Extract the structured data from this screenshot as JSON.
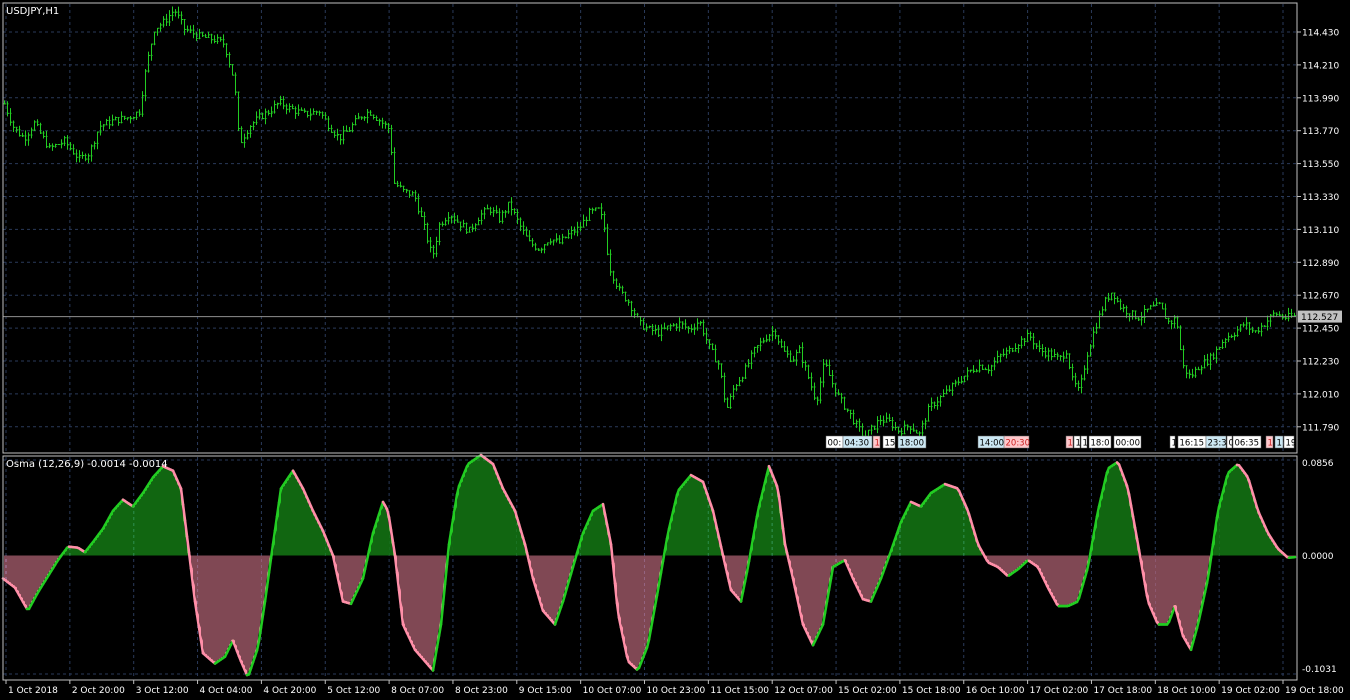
{
  "window": {
    "main_title": "USDJPY,H1",
    "indicator_title": "Osma (12,26,9) -0.0014 -0.0014"
  },
  "colors": {
    "background": "#000000",
    "frame": "#c0c0c0",
    "grid": "#2a3a5a",
    "candle": "#22cc22",
    "price_line": "#909090",
    "price_label_bg": "#c0c0c0",
    "osma_positive": "#22cc22",
    "osma_negative": "#ff8fa8",
    "text": "#ffffff"
  },
  "price_axis": {
    "labels": [
      "114.430",
      "114.210",
      "113.990",
      "113.770",
      "113.550",
      "113.330",
      "113.110",
      "112.890",
      "112.670",
      "112.450",
      "112.230",
      "112.010",
      "111.790"
    ],
    "current_price": "112.527"
  },
  "osma_axis": {
    "labels": [
      "0.0856",
      "0.0000",
      "-0.1031"
    ]
  },
  "time_axis": {
    "labels": [
      "1 Oct 2018",
      "2 Oct 20:00",
      "3 Oct 12:00",
      "4 Oct 04:00",
      "4 Oct 20:00",
      "5 Oct 12:00",
      "8 Oct 07:00",
      "8 Oct 23:00",
      "9 Oct 15:00",
      "10 Oct 07:00",
      "10 Oct 23:00",
      "11 Oct 15:00",
      "12 Oct 07:00",
      "15 Oct 02:00",
      "15 Oct 18:00",
      "16 Oct 10:00",
      "17 Oct 02:00",
      "17 Oct 18:00",
      "18 Oct 10:00",
      "19 Oct 02:00",
      "19 Oct 18:00"
    ]
  },
  "event_markers": [
    {
      "text": "00:",
      "tone": "white"
    },
    {
      "text": "04:30",
      "tone": "blue"
    },
    {
      "text": "1",
      "tone": "pink"
    },
    {
      "text": "15",
      "tone": "white"
    },
    {
      "text": "18:00",
      "tone": "blue"
    },
    {
      "text": "14:00",
      "tone": "blue"
    },
    {
      "text": "20:30",
      "tone": "pink"
    },
    {
      "text": "1",
      "tone": "pink"
    },
    {
      "text": "1",
      "tone": "white"
    },
    {
      "text": "1",
      "tone": "white"
    },
    {
      "text": "18:0",
      "tone": "white"
    },
    {
      "text": "00:00",
      "tone": "white"
    },
    {
      "text": "1",
      "tone": "white"
    },
    {
      "text": "16:15",
      "tone": "white"
    },
    {
      "text": "23:3",
      "tone": "blue"
    },
    {
      "text": "0",
      "tone": "white"
    },
    {
      "text": "06:35",
      "tone": "white"
    },
    {
      "text": "1",
      "tone": "pink"
    },
    {
      "text": "1",
      "tone": "blue"
    },
    {
      "text": "19",
      "tone": "white"
    }
  ],
  "chart_data": [
    {
      "type": "candlestick",
      "title": "USDJPY,H1",
      "ylim": [
        111.64,
        114.6
      ],
      "x_start": "1 Oct 2018",
      "x_end": "19 Oct 18:00",
      "y_ticks": [
        114.43,
        114.21,
        113.99,
        113.77,
        113.55,
        113.33,
        113.11,
        112.89,
        112.67,
        112.45,
        112.23,
        112.01,
        111.79
      ],
      "current_price": 112.527,
      "close_path": [
        [
          0,
          113.95
        ],
        [
          10,
          113.78
        ],
        [
          20,
          113.72
        ],
        [
          30,
          113.82
        ],
        [
          45,
          113.65
        ],
        [
          60,
          113.7
        ],
        [
          75,
          113.58
        ],
        [
          85,
          113.62
        ],
        [
          95,
          113.8
        ],
        [
          110,
          113.84
        ],
        [
          125,
          113.86
        ],
        [
          135,
          113.9
        ],
        [
          142,
          114.2
        ],
        [
          150,
          114.45
        ],
        [
          160,
          114.5
        ],
        [
          170,
          114.58
        ],
        [
          180,
          114.45
        ],
        [
          195,
          114.4
        ],
        [
          210,
          114.38
        ],
        [
          220,
          114.35
        ],
        [
          230,
          114.1
        ],
        [
          235,
          113.68
        ],
        [
          245,
          113.8
        ],
        [
          255,
          113.86
        ],
        [
          265,
          113.9
        ],
        [
          275,
          113.96
        ],
        [
          285,
          113.92
        ],
        [
          300,
          113.88
        ],
        [
          315,
          113.9
        ],
        [
          325,
          113.8
        ],
        [
          335,
          113.72
        ],
        [
          345,
          113.78
        ],
        [
          355,
          113.86
        ],
        [
          365,
          113.9
        ],
        [
          375,
          113.84
        ],
        [
          385,
          113.78
        ],
        [
          390,
          113.42
        ],
        [
          400,
          113.36
        ],
        [
          410,
          113.34
        ],
        [
          420,
          113.12
        ],
        [
          428,
          112.92
        ],
        [
          435,
          113.14
        ],
        [
          445,
          113.22
        ],
        [
          455,
          113.15
        ],
        [
          465,
          113.1
        ],
        [
          475,
          113.2
        ],
        [
          485,
          113.25
        ],
        [
          495,
          113.18
        ],
        [
          505,
          113.28
        ],
        [
          515,
          113.14
        ],
        [
          525,
          113.02
        ],
        [
          535,
          112.98
        ],
        [
          545,
          113.05
        ],
        [
          555,
          113.02
        ],
        [
          565,
          113.08
        ],
        [
          575,
          113.12
        ],
        [
          585,
          113.22
        ],
        [
          595,
          113.24
        ],
        [
          600,
          113.12
        ],
        [
          605,
          112.86
        ],
        [
          615,
          112.7
        ],
        [
          625,
          112.62
        ],
        [
          635,
          112.48
        ],
        [
          645,
          112.44
        ],
        [
          655,
          112.42
        ],
        [
          665,
          112.46
        ],
        [
          675,
          112.48
        ],
        [
          685,
          112.44
        ],
        [
          695,
          112.5
        ],
        [
          705,
          112.32
        ],
        [
          715,
          112.2
        ],
        [
          722,
          111.9
        ],
        [
          730,
          112.06
        ],
        [
          740,
          112.16
        ],
        [
          750,
          112.3
        ],
        [
          760,
          112.38
        ],
        [
          770,
          112.44
        ],
        [
          778,
          112.3
        ],
        [
          788,
          112.24
        ],
        [
          795,
          112.3
        ],
        [
          805,
          112.1
        ],
        [
          812,
          111.96
        ],
        [
          820,
          112.22
        ],
        [
          828,
          112.08
        ],
        [
          835,
          111.98
        ],
        [
          845,
          111.88
        ],
        [
          852,
          111.8
        ],
        [
          860,
          111.72
        ],
        [
          868,
          111.78
        ],
        [
          876,
          111.84
        ],
        [
          885,
          111.82
        ],
        [
          895,
          111.76
        ],
        [
          905,
          111.8
        ],
        [
          915,
          111.74
        ],
        [
          925,
          111.92
        ],
        [
          935,
          111.98
        ],
        [
          945,
          112.04
        ],
        [
          955,
          112.1
        ],
        [
          965,
          112.16
        ],
        [
          975,
          112.2
        ],
        [
          985,
          112.18
        ],
        [
          995,
          112.26
        ],
        [
          1005,
          112.3
        ],
        [
          1015,
          112.36
        ],
        [
          1025,
          112.4
        ],
        [
          1035,
          112.3
        ],
        [
          1045,
          112.28
        ],
        [
          1055,
          112.24
        ],
        [
          1062,
          112.3
        ],
        [
          1068,
          112.1
        ],
        [
          1075,
          112.02
        ],
        [
          1082,
          112.26
        ],
        [
          1090,
          112.44
        ],
        [
          1100,
          112.62
        ],
        [
          1108,
          112.7
        ],
        [
          1115,
          112.6
        ],
        [
          1125,
          112.55
        ],
        [
          1135,
          112.52
        ],
        [
          1145,
          112.58
        ],
        [
          1155,
          112.6
        ],
        [
          1165,
          112.48
        ],
        [
          1172,
          112.52
        ],
        [
          1178,
          112.2
        ],
        [
          1186,
          112.12
        ],
        [
          1195,
          112.2
        ],
        [
          1205,
          112.24
        ],
        [
          1212,
          112.3
        ],
        [
          1220,
          112.38
        ],
        [
          1230,
          112.42
        ],
        [
          1240,
          112.48
        ],
        [
          1250,
          112.42
        ],
        [
          1260,
          112.48
        ],
        [
          1270,
          112.55
        ],
        [
          1280,
          112.52
        ],
        [
          1292,
          112.53
        ]
      ]
    },
    {
      "type": "histogram",
      "title": "Osma (12,26,9) -0.0014 -0.0014",
      "series": [
        {
          "name": "Osma",
          "values": "osma_path"
        }
      ],
      "ylim": [
        -0.1031,
        0.0856
      ],
      "y_ticks": [
        0.0856,
        0.0,
        -0.1031
      ],
      "osma_path": [
        [
          0,
          -0.02
        ],
        [
          12,
          -0.028
        ],
        [
          25,
          -0.048
        ],
        [
          35,
          -0.032
        ],
        [
          45,
          -0.018
        ],
        [
          55,
          -0.004
        ],
        [
          65,
          0.008
        ],
        [
          75,
          0.007
        ],
        [
          82,
          0.003
        ],
        [
          90,
          0.012
        ],
        [
          100,
          0.024
        ],
        [
          110,
          0.04
        ],
        [
          120,
          0.05
        ],
        [
          130,
          0.044
        ],
        [
          140,
          0.056
        ],
        [
          150,
          0.07
        ],
        [
          160,
          0.08
        ],
        [
          170,
          0.076
        ],
        [
          178,
          0.06
        ],
        [
          185,
          0.01
        ],
        [
          192,
          -0.04
        ],
        [
          200,
          -0.085
        ],
        [
          212,
          -0.094
        ],
        [
          222,
          -0.088
        ],
        [
          230,
          -0.074
        ],
        [
          237,
          -0.09
        ],
        [
          245,
          -0.106
        ],
        [
          255,
          -0.08
        ],
        [
          262,
          -0.04
        ],
        [
          270,
          0.01
        ],
        [
          278,
          0.06
        ],
        [
          290,
          0.076
        ],
        [
          300,
          0.06
        ],
        [
          310,
          0.04
        ],
        [
          320,
          0.022
        ],
        [
          330,
          0.0
        ],
        [
          340,
          -0.04
        ],
        [
          348,
          -0.042
        ],
        [
          360,
          -0.02
        ],
        [
          370,
          0.02
        ],
        [
          380,
          0.048
        ],
        [
          385,
          0.04
        ],
        [
          392,
          0.0
        ],
        [
          400,
          -0.06
        ],
        [
          412,
          -0.082
        ],
        [
          420,
          -0.09
        ],
        [
          430,
          -0.1
        ],
        [
          438,
          -0.06
        ],
        [
          446,
          0.01
        ],
        [
          455,
          0.06
        ],
        [
          465,
          0.082
        ],
        [
          478,
          0.09
        ],
        [
          490,
          0.082
        ],
        [
          500,
          0.06
        ],
        [
          512,
          0.04
        ],
        [
          522,
          0.01
        ],
        [
          530,
          -0.02
        ],
        [
          540,
          -0.048
        ],
        [
          552,
          -0.06
        ],
        [
          560,
          -0.04
        ],
        [
          570,
          -0.01
        ],
        [
          580,
          0.02
        ],
        [
          590,
          0.04
        ],
        [
          600,
          0.046
        ],
        [
          608,
          0.01
        ],
        [
          615,
          -0.05
        ],
        [
          625,
          -0.092
        ],
        [
          635,
          -0.1
        ],
        [
          645,
          -0.078
        ],
        [
          655,
          -0.03
        ],
        [
          665,
          0.02
        ],
        [
          675,
          0.058
        ],
        [
          688,
          0.072
        ],
        [
          700,
          0.066
        ],
        [
          710,
          0.04
        ],
        [
          720,
          0.0
        ],
        [
          728,
          -0.03
        ],
        [
          738,
          -0.04
        ],
        [
          745,
          -0.01
        ],
        [
          755,
          0.04
        ],
        [
          766,
          0.08
        ],
        [
          775,
          0.06
        ],
        [
          782,
          0.01
        ],
        [
          790,
          -0.02
        ],
        [
          800,
          -0.06
        ],
        [
          810,
          -0.078
        ],
        [
          820,
          -0.06
        ],
        [
          830,
          -0.01
        ],
        [
          842,
          -0.004
        ],
        [
          850,
          -0.02
        ],
        [
          860,
          -0.038
        ],
        [
          868,
          -0.04
        ],
        [
          878,
          -0.02
        ],
        [
          888,
          0.004
        ],
        [
          898,
          0.03
        ],
        [
          908,
          0.048
        ],
        [
          918,
          0.044
        ],
        [
          928,
          0.056
        ],
        [
          942,
          0.064
        ],
        [
          955,
          0.06
        ],
        [
          965,
          0.04
        ],
        [
          975,
          0.01
        ],
        [
          985,
          -0.006
        ],
        [
          995,
          -0.01
        ],
        [
          1005,
          -0.018
        ],
        [
          1015,
          -0.012
        ],
        [
          1025,
          -0.004
        ],
        [
          1035,
          -0.01
        ],
        [
          1045,
          -0.028
        ],
        [
          1055,
          -0.044
        ],
        [
          1065,
          -0.044
        ],
        [
          1075,
          -0.04
        ],
        [
          1085,
          -0.01
        ],
        [
          1095,
          0.04
        ],
        [
          1105,
          0.078
        ],
        [
          1115,
          0.084
        ],
        [
          1125,
          0.06
        ],
        [
          1135,
          0.01
        ],
        [
          1145,
          -0.04
        ],
        [
          1155,
          -0.06
        ],
        [
          1165,
          -0.06
        ],
        [
          1172,
          -0.044
        ],
        [
          1180,
          -0.07
        ],
        [
          1188,
          -0.082
        ],
        [
          1195,
          -0.06
        ],
        [
          1205,
          -0.02
        ],
        [
          1215,
          0.04
        ],
        [
          1225,
          0.074
        ],
        [
          1235,
          0.082
        ],
        [
          1245,
          0.07
        ],
        [
          1255,
          0.04
        ],
        [
          1265,
          0.02
        ],
        [
          1275,
          0.006
        ],
        [
          1285,
          -0.002
        ],
        [
          1292,
          -0.0014
        ]
      ]
    }
  ]
}
